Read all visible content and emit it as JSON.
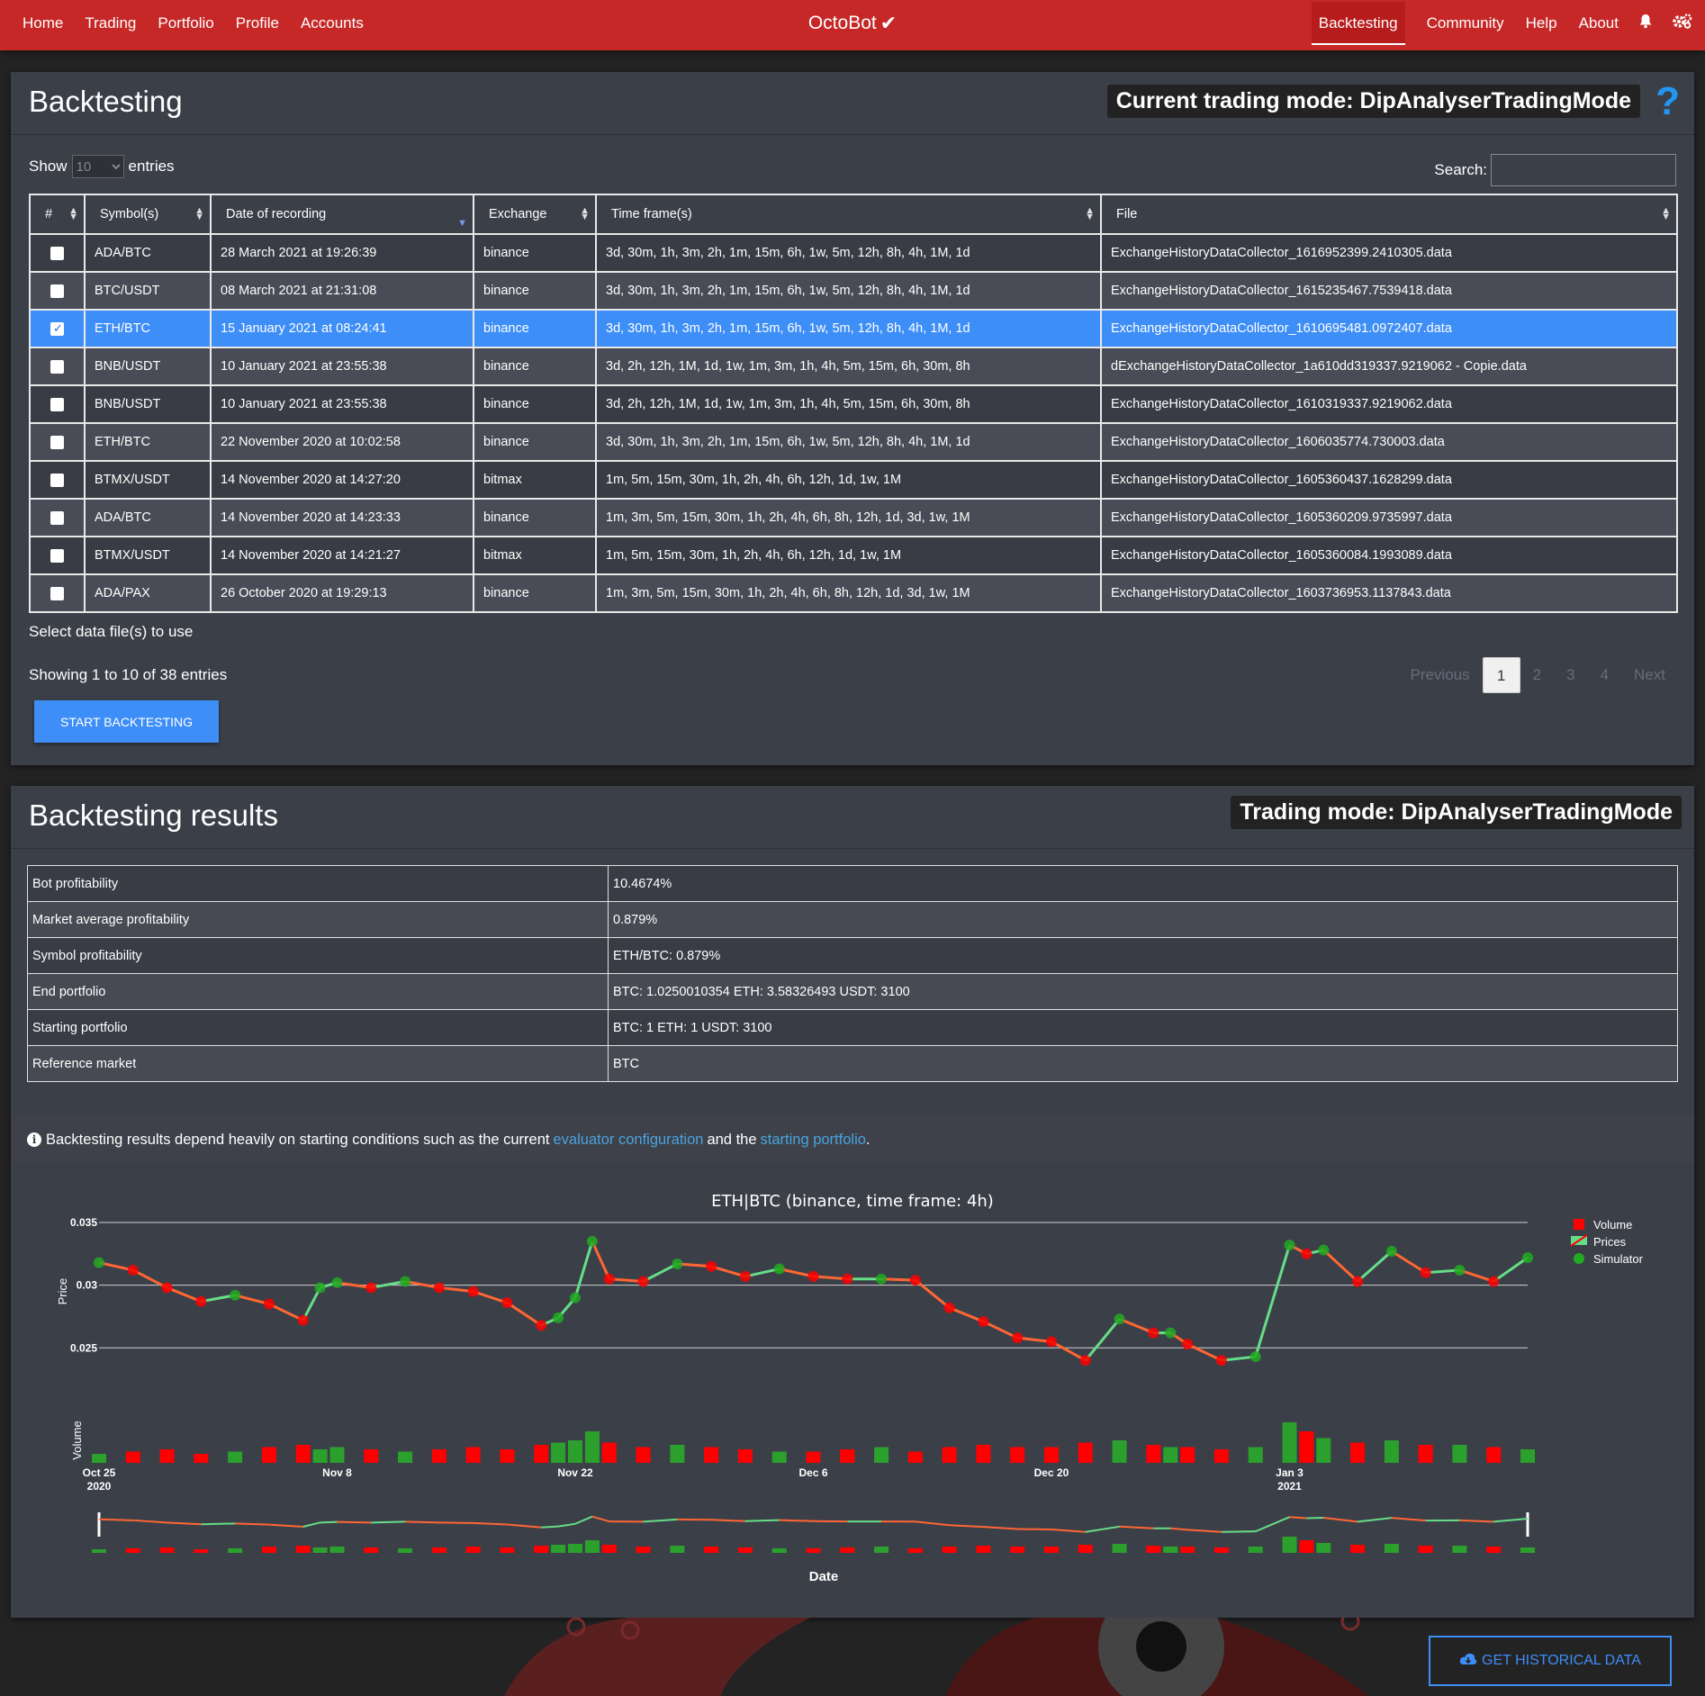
{
  "nav": {
    "left": [
      "Home",
      "Trading",
      "Portfolio",
      "Profile",
      "Accounts"
    ],
    "brand": "OctoBot",
    "right": [
      "Backtesting",
      "Community",
      "Help",
      "About"
    ],
    "active": "Backtesting"
  },
  "backtesting": {
    "title": "Backtesting",
    "mode_label": "Current trading mode: DipAnalyserTradingMode",
    "show_label": "Show",
    "entries_label": "entries",
    "show_value": "10",
    "search_label": "Search:",
    "columns": [
      "#",
      "Symbol(s)",
      "Date of recording",
      "Exchange",
      "Time frame(s)",
      "File"
    ],
    "rows": [
      {
        "symbol": "ADA/BTC",
        "date": "28 March 2021 at 19:26:39",
        "exchange": "binance",
        "timeframes": "3d, 30m, 1h, 3m, 2h, 1m, 15m, 6h, 1w, 5m, 12h, 8h, 4h, 1M, 1d",
        "file": "ExchangeHistoryDataCollector_1616952399.2410305.data",
        "checked": false
      },
      {
        "symbol": "BTC/USDT",
        "date": "08 March 2021 at 21:31:08",
        "exchange": "binance",
        "timeframes": "3d, 30m, 1h, 3m, 2h, 1m, 15m, 6h, 1w, 5m, 12h, 8h, 4h, 1M, 1d",
        "file": "ExchangeHistoryDataCollector_1615235467.7539418.data",
        "checked": false
      },
      {
        "symbol": "ETH/BTC",
        "date": "15 January 2021 at 08:24:41",
        "exchange": "binance",
        "timeframes": "3d, 30m, 1h, 3m, 2h, 1m, 15m, 6h, 1w, 5m, 12h, 8h, 4h, 1M, 1d",
        "file": "ExchangeHistoryDataCollector_1610695481.0972407.data",
        "checked": true
      },
      {
        "symbol": "BNB/USDT",
        "date": "10 January 2021 at 23:55:38",
        "exchange": "binance",
        "timeframes": "3d, 2h, 12h, 1M, 1d, 1w, 1m, 3m, 1h, 4h, 5m, 15m, 6h, 30m, 8h",
        "file": "dExchangeHistoryDataCollector_1a610dd319337.9219062 - Copie.data",
        "checked": false
      },
      {
        "symbol": "BNB/USDT",
        "date": "10 January 2021 at 23:55:38",
        "exchange": "binance",
        "timeframes": "3d, 2h, 12h, 1M, 1d, 1w, 1m, 3m, 1h, 4h, 5m, 15m, 6h, 30m, 8h",
        "file": "ExchangeHistoryDataCollector_1610319337.9219062.data",
        "checked": false
      },
      {
        "symbol": "ETH/BTC",
        "date": "22 November 2020 at 10:02:58",
        "exchange": "binance",
        "timeframes": "3d, 30m, 1h, 3m, 2h, 1m, 15m, 6h, 1w, 5m, 12h, 8h, 4h, 1M, 1d",
        "file": "ExchangeHistoryDataCollector_1606035774.730003.data",
        "checked": false
      },
      {
        "symbol": "BTMX/USDT",
        "date": "14 November 2020 at 14:27:20",
        "exchange": "bitmax",
        "timeframes": "1m, 5m, 15m, 30m, 1h, 2h, 4h, 6h, 12h, 1d, 1w, 1M",
        "file": "ExchangeHistoryDataCollector_1605360437.1628299.data",
        "checked": false
      },
      {
        "symbol": "ADA/BTC",
        "date": "14 November 2020 at 14:23:33",
        "exchange": "binance",
        "timeframes": "1m, 3m, 5m, 15m, 30m, 1h, 2h, 4h, 6h, 8h, 12h, 1d, 3d, 1w, 1M",
        "file": "ExchangeHistoryDataCollector_1605360209.9735997.data",
        "checked": false
      },
      {
        "symbol": "BTMX/USDT",
        "date": "14 November 2020 at 14:21:27",
        "exchange": "bitmax",
        "timeframes": "1m, 5m, 15m, 30m, 1h, 2h, 4h, 6h, 12h, 1d, 1w, 1M",
        "file": "ExchangeHistoryDataCollector_1605360084.1993089.data",
        "checked": false
      },
      {
        "symbol": "ADA/PAX",
        "date": "26 October 2020 at 19:29:13",
        "exchange": "binance",
        "timeframes": "1m, 3m, 5m, 15m, 30m, 1h, 2h, 4h, 6h, 8h, 12h, 1d, 3d, 1w, 1M",
        "file": "ExchangeHistoryDataCollector_1603736953.1137843.data",
        "checked": false
      }
    ],
    "select_label": "Select data file(s) to use",
    "showing_info": "Showing 1 to 10 of 38 entries",
    "pagination": {
      "previous": "Previous",
      "pages": [
        "1",
        "2",
        "3",
        "4"
      ],
      "current": "1",
      "next": "Next"
    },
    "start_button": "START BACKTESTING"
  },
  "results": {
    "title": "Backtesting results",
    "mode_label": "Trading mode: DipAnalyserTradingMode",
    "rows": [
      {
        "key": "Bot profitability",
        "value": "10.4674%"
      },
      {
        "key": "Market average profitability",
        "value": "0.879%"
      },
      {
        "key": "Symbol profitability",
        "value": "ETH/BTC: 0.879%"
      },
      {
        "key": "End portfolio",
        "value": "BTC: 1.0250010354 ETH: 3.58326493 USDT: 3100"
      },
      {
        "key": "Starting portfolio",
        "value": "BTC: 1 ETH: 1 USDT: 3100"
      },
      {
        "key": "Reference market",
        "value": "BTC"
      }
    ],
    "info": {
      "prefix": "Backtesting results depend heavily on starting conditions such as the current",
      "link1": "evaluator configuration",
      "middle": "and the",
      "link2": "starting portfolio",
      "suffix": "."
    }
  },
  "chart_data": {
    "type": "line",
    "title": "ETH|BTC (binance, time frame: 4h)",
    "ylabel": "Price",
    "volume_label": "Volume",
    "xlabel": "Date",
    "ylim": [
      0.0205,
      0.035
    ],
    "y_ticks": [
      "0.035",
      "0.03",
      "0.025"
    ],
    "x_ticks": [
      {
        "label": "Oct 25",
        "sub": "2020",
        "day": 0
      },
      {
        "label": "Nov 8",
        "sub": "",
        "day": 14
      },
      {
        "label": "Nov 22",
        "sub": "",
        "day": 28
      },
      {
        "label": "Dec 6",
        "sub": "",
        "day": 42
      },
      {
        "label": "Dec 20",
        "sub": "",
        "day": 56
      },
      {
        "label": "Jan 3",
        "sub": "2021",
        "day": 70
      }
    ],
    "legend": [
      "Volume",
      "Prices",
      "Simulator"
    ],
    "legend_position": "top-right",
    "colors": {
      "up": "#2ca02c",
      "down": "#ff0000",
      "line_up": "#66dd88",
      "line_down": "#ff6633",
      "sim": "#22aa22"
    },
    "x": [
      0,
      2,
      4,
      6,
      8,
      10,
      12,
      13,
      14,
      16,
      18,
      20,
      22,
      24,
      26,
      27,
      28,
      29,
      30,
      32,
      34,
      36,
      38,
      40,
      42,
      44,
      46,
      48,
      50,
      52,
      54,
      56,
      58,
      60,
      62,
      63,
      64,
      66,
      68,
      70,
      71,
      72,
      74,
      76,
      78,
      80,
      82,
      84
    ],
    "y": [
      0.0318,
      0.0312,
      0.0298,
      0.0287,
      0.0292,
      0.0285,
      0.0272,
      0.0298,
      0.0302,
      0.0298,
      0.0303,
      0.0298,
      0.0295,
      0.0286,
      0.0268,
      0.0274,
      0.029,
      0.0335,
      0.0305,
      0.0303,
      0.0317,
      0.0315,
      0.0307,
      0.0313,
      0.0307,
      0.0305,
      0.0305,
      0.0304,
      0.0282,
      0.0271,
      0.0258,
      0.0255,
      0.024,
      0.0273,
      0.0262,
      0.0262,
      0.0253,
      0.024,
      0.0243,
      0.0332,
      0.0325,
      0.0328,
      0.0303,
      0.0327,
      0.031,
      0.0312,
      0.0303,
      0.0322
    ],
    "volume_ylim": [
      0,
      1
    ],
    "volume": [
      0.2,
      0.25,
      0.3,
      0.2,
      0.25,
      0.35,
      0.4,
      0.3,
      0.35,
      0.3,
      0.25,
      0.3,
      0.35,
      0.3,
      0.4,
      0.45,
      0.5,
      0.7,
      0.45,
      0.35,
      0.4,
      0.35,
      0.3,
      0.25,
      0.25,
      0.3,
      0.35,
      0.25,
      0.35,
      0.4,
      0.35,
      0.35,
      0.45,
      0.5,
      0.4,
      0.35,
      0.35,
      0.3,
      0.35,
      0.9,
      0.7,
      0.55,
      0.45,
      0.5,
      0.4,
      0.4,
      0.35,
      0.3
    ]
  },
  "hist_button": "GET HISTORICAL DATA"
}
